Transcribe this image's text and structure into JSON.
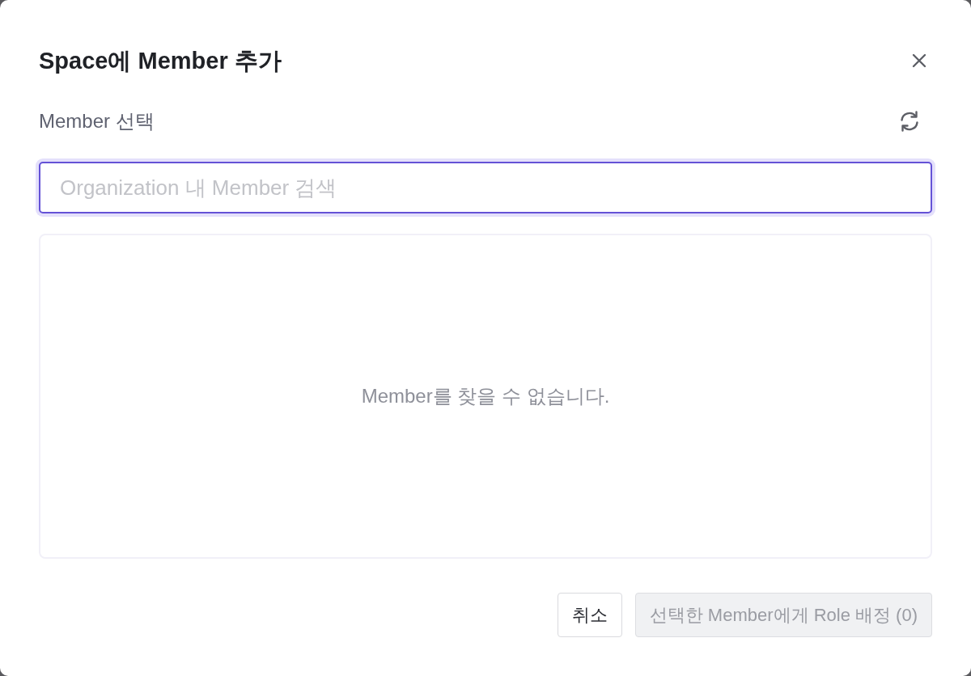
{
  "dialog": {
    "title": "Space에 Member 추가"
  },
  "section": {
    "label": "Member 선택"
  },
  "search": {
    "placeholder": "Organization 내 Member 검색",
    "focused": true
  },
  "results": {
    "empty_message": "Member를 찾을 수 없습니다."
  },
  "buttons": [
    {
      "label": "취소",
      "kind": "secondary",
      "disabled": false
    },
    {
      "label": "선택한 Member에게 Role 배정 (0)",
      "kind": "primary",
      "disabled": true
    }
  ]
}
